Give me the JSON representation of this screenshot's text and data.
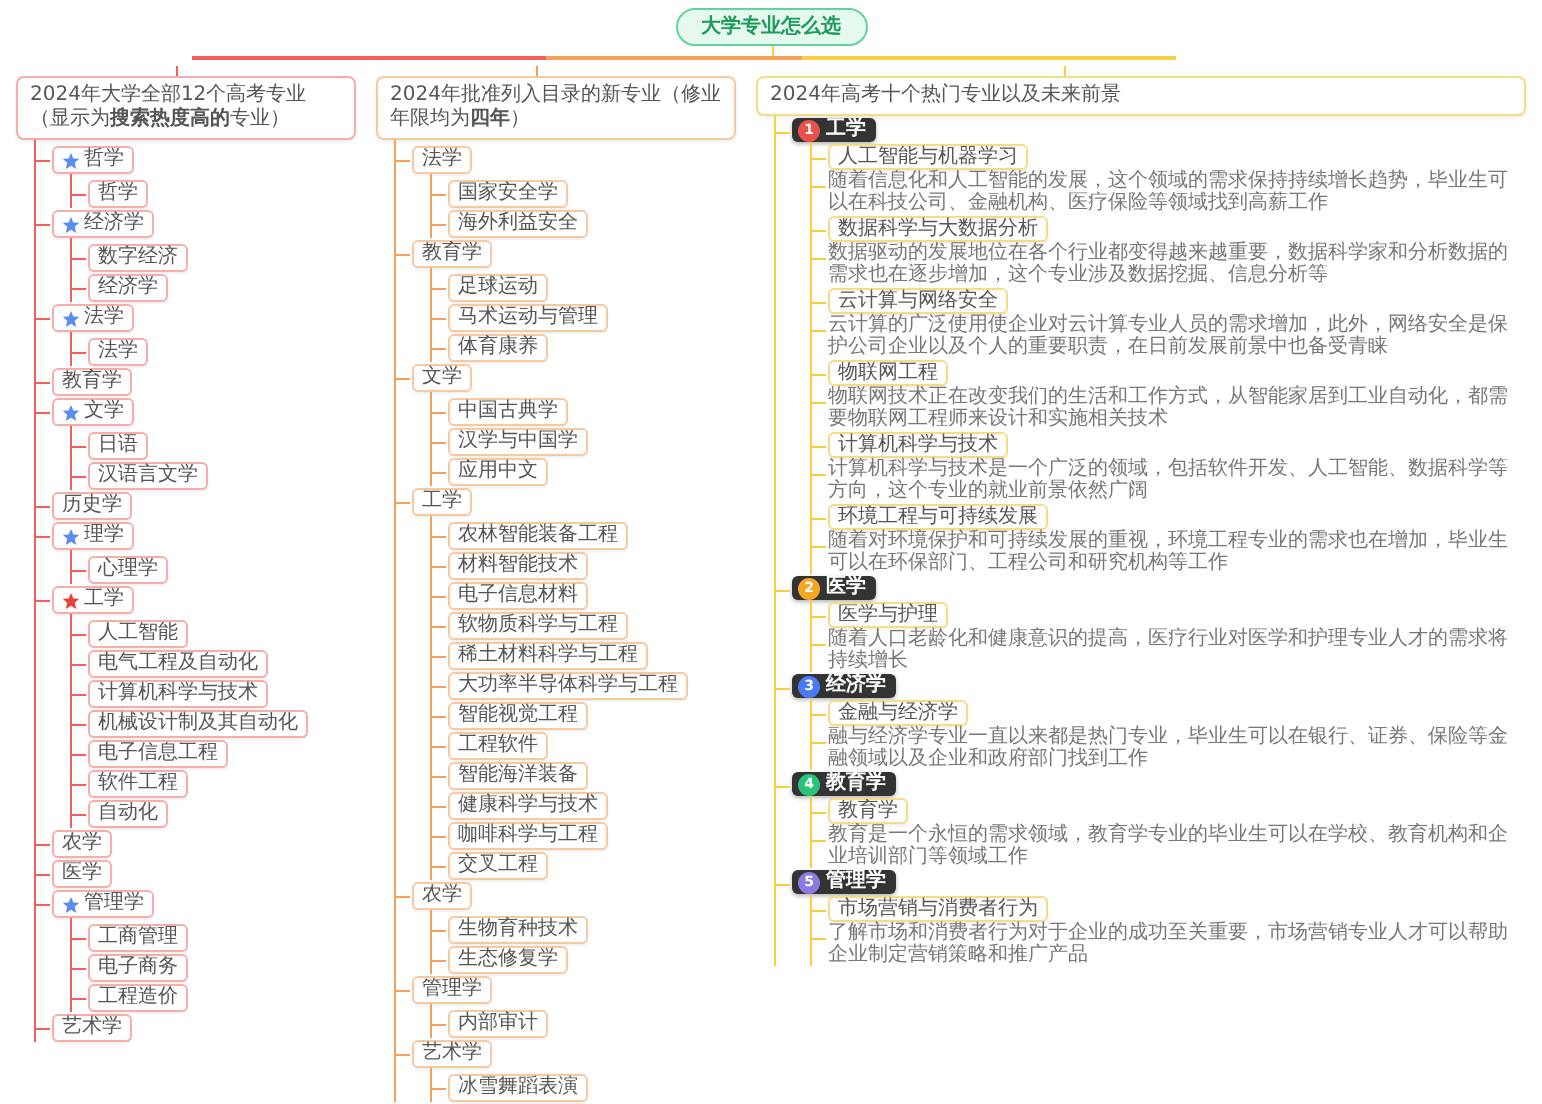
{
  "root": {
    "title": "大学专业怎么选"
  },
  "branches": [
    {
      "kind": "tree",
      "title": "2024年大学全部12个高考专业（显示为**搜索热度高的**专业）",
      "items": [
        {
          "label": "哲学",
          "color": "#5b8def",
          "children": [
            {
              "label": "哲学"
            }
          ]
        },
        {
          "label": "经济学",
          "color": "#5b8def",
          "children": [
            {
              "label": "数字经济"
            },
            {
              "label": "经济学"
            }
          ]
        },
        {
          "label": "法学",
          "color": "#5b8def",
          "children": [
            {
              "label": "法学"
            }
          ]
        },
        {
          "label": "教育学"
        },
        {
          "label": "文学",
          "color": "#5b8def",
          "children": [
            {
              "label": "日语"
            },
            {
              "label": "汉语言文学"
            }
          ]
        },
        {
          "label": "历史学"
        },
        {
          "label": "理学",
          "color": "#5b8def",
          "children": [
            {
              "label": "心理学"
            }
          ]
        },
        {
          "label": "工学",
          "color": "#e8403a",
          "children": [
            {
              "label": "人工智能"
            },
            {
              "label": "电气工程及自动化"
            },
            {
              "label": "计算机科学与技术"
            },
            {
              "label": "机械设计制及其自动化"
            },
            {
              "label": "电子信息工程"
            },
            {
              "label": "软件工程"
            },
            {
              "label": "自动化"
            }
          ]
        },
        {
          "label": "农学"
        },
        {
          "label": "医学"
        },
        {
          "label": "管理学",
          "color": "#5b8def",
          "children": [
            {
              "label": "工商管理"
            },
            {
              "label": "电子商务"
            },
            {
              "label": "工程造价"
            }
          ]
        },
        {
          "label": "艺术学"
        }
      ]
    },
    {
      "kind": "tree",
      "title": "2024年批准列入目录的新专业（修业年限均为**四年**）",
      "items": [
        {
          "label": "法学",
          "children": [
            {
              "label": "国家安全学"
            },
            {
              "label": "海外利益安全"
            }
          ]
        },
        {
          "label": "教育学",
          "children": [
            {
              "label": "足球运动"
            },
            {
              "label": "马术运动与管理"
            },
            {
              "label": "体育康养"
            }
          ]
        },
        {
          "label": "文学",
          "children": [
            {
              "label": "中国古典学"
            },
            {
              "label": "汉学与中国学"
            },
            {
              "label": "应用中文"
            }
          ]
        },
        {
          "label": "工学",
          "children": [
            {
              "label": "农林智能装备工程"
            },
            {
              "label": "材料智能技术"
            },
            {
              "label": "电子信息材料"
            },
            {
              "label": "软物质科学与工程"
            },
            {
              "label": "稀土材料科学与工程"
            },
            {
              "label": "大功率半导体科学与工程"
            },
            {
              "label": "智能视觉工程"
            },
            {
              "label": "工程软件"
            },
            {
              "label": "智能海洋装备"
            },
            {
              "label": "健康科学与技术"
            },
            {
              "label": "咖啡科学与工程"
            },
            {
              "label": "交叉工程"
            }
          ]
        },
        {
          "label": "农学",
          "children": [
            {
              "label": "生物育种技术"
            },
            {
              "label": "生态修复学"
            }
          ]
        },
        {
          "label": "管理学",
          "children": [
            {
              "label": "内部审计"
            }
          ]
        },
        {
          "label": "艺术学",
          "children": [
            {
              "label": "冰雪舞蹈表演"
            }
          ]
        }
      ]
    },
    {
      "kind": "prospects",
      "title": "2024年高考十个热门专业以及未来前景",
      "fields": [
        {
          "number": "1",
          "label": "工学",
          "color": "#e8524a",
          "topics": [
            {
              "label": "人工智能与机器学习",
              "description": "随着信息化和人工智能的发展，这个领域的需求保持持续增长趋势，毕业生可以在科技公司、金融机构、医疗保险等领域找到高薪工作"
            },
            {
              "label": "数据科学与大数据分析",
              "description": "数据驱动的发展地位在各个行业都变得越来越重要，数据科学家和分析数据的需求也在逐步增加，这个专业涉及数据挖掘、信息分析等"
            },
            {
              "label": "云计算与网络安全",
              "description": "云计算的广泛使用使企业对云计算专业人员的需求增加，此外，网络安全是保护公司企业以及个人的重要职责，在日前发展前景中也备受青睐"
            },
            {
              "label": "物联网工程",
              "description": "物联网技术正在改变我们的生活和工作方式，从智能家居到工业自动化，都需要物联网工程师来设计和实施相关技术"
            },
            {
              "label": "计算机科学与技术",
              "description": "计算机科学与技术是一个广泛的领域，包括软件开发、人工智能、数据科学等方向，这个专业的就业前景依然广阔"
            },
            {
              "label": "环境工程与可持续发展",
              "description": "随着对环境保护和可持续发展的重视，环境工程专业的需求也在增加，毕业生可以在环保部门、工程公司和研究机构等工作"
            }
          ]
        },
        {
          "number": "2",
          "label": "医学",
          "color": "#f5a623",
          "topics": [
            {
              "label": "医学与护理",
              "description": "随着人口老龄化和健康意识的提高，医疗行业对医学和护理专业人才的需求将持续增长"
            }
          ]
        },
        {
          "number": "3",
          "label": "经济学",
          "color": "#4a7bf7",
          "topics": [
            {
              "label": "金融与经济学",
              "description": "融与经济学专业一直以来都是热门专业，毕业生可以在银行、证券、保险等金融领域以及企业和政府部门找到工作"
            }
          ]
        },
        {
          "number": "4",
          "label": "教育学",
          "color": "#27c47a",
          "topics": [
            {
              "label": "教育学",
              "description": "教育是一个永恒的需求领域，教育学专业的毕业生可以在学校、教育机构和企业培训部门等领域工作"
            }
          ]
        },
        {
          "number": "5",
          "label": "管理学",
          "color": "#8a7be0",
          "topics": [
            {
              "label": "市场营销与消费者行为",
              "description": "了解市场和消费者行为对于企业的成功至关重要，市场营销专业人才可以帮助企业制定营销策略和推广产品"
            }
          ]
        }
      ]
    }
  ]
}
